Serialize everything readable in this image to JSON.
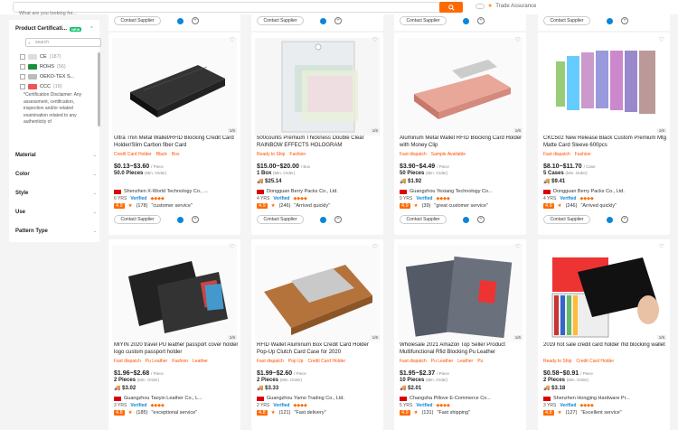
{
  "search": {
    "placeholder": "What are you looking for..."
  },
  "trade_assurance": "Trade Assurance",
  "sidebar": {
    "title": "Product Certificati...",
    "new_badge": "NEW",
    "search_placeholder": "search",
    "certs": [
      {
        "label": "CE",
        "count": "(187)",
        "color": "#333"
      },
      {
        "label": "ROHS",
        "count": "(56)",
        "color": "#1a8f3c"
      },
      {
        "label": "OEKO-TEX S...",
        "count": "",
        "color": "#888"
      },
      {
        "label": "CCC",
        "count": "(18)",
        "color": "#c00"
      }
    ],
    "disclaimer": "*Certification Disclaimer: Any assessment, certification, inspection and/or related examination related to any authenticity of",
    "facets": [
      "Material",
      "Color",
      "Style",
      "Use",
      "Pattern Type"
    ]
  },
  "contact_label": "Contact Supplier",
  "cards": [
    {
      "title": "Ultra Thin Metal Wallet/RFID Blocking Credit Card Holder/Slim Carbon fiber Card",
      "tags": [
        "Credit Card Holder",
        "Black",
        "Box"
      ],
      "price": "$0.13~$3.60",
      "unit": "/ Piece",
      "min": "50.0 Pieces",
      "min_note": "(Min. Order)",
      "ship": "",
      "supplier": "Shenzhen X-World Technology Co., ...",
      "yrs": "6 YRS",
      "rate": "\"customer service\"",
      "score": "4.9",
      "reviews": "(178)",
      "page": "1/6"
    },
    {
      "title": "500counts Premium Thickness Double Clear RAINBOW EFFECTS HOLOGRAM",
      "tags": [
        "Ready to Ship",
        "Fashion"
      ],
      "price": "$15.00~$20.00",
      "unit": "/ Box",
      "min": "1 Box",
      "min_note": "(Min. Order)",
      "ship": "$25.14",
      "supplier": "Dongguan Berry Packs Co., Ltd.",
      "yrs": "4 YRS",
      "rate": "\"Arrived quickly\"",
      "score": "4.9",
      "reviews": "(246)",
      "page": "1/6"
    },
    {
      "title": "Aluminum Metal Wallet RFID Blocking Card Holder with Money Clip",
      "tags": [
        "Fast dispatch",
        "Sample Available"
      ],
      "price": "$3.90~$4.49",
      "unit": "/ Piece",
      "min": "50 Pieces",
      "min_note": "(Min. Order)",
      "ship": "$1.92",
      "supplier": "Guangzhou Yexiang Technology Co...",
      "yrs": "9 YRS",
      "rate": "\"great customer service\"",
      "score": "4.9",
      "reviews": "(39)",
      "page": "1/6"
    },
    {
      "title": "CKC502 New Release Black Custom Premium Mtg Matte Card Sleeve 600pcs",
      "tags": [
        "Fast dispatch",
        "Fashion"
      ],
      "price": "$8.10~$11.70",
      "unit": "/ Case",
      "min": "5 Cases",
      "min_note": "(Min. Order)",
      "ship": "$9.41",
      "supplier": "Dongguan Berry Packs Co., Ltd.",
      "yrs": "4 YRS",
      "rate": "\"Arrived quickly\"",
      "score": "4.9",
      "reviews": "(246)",
      "page": "1/6"
    },
    {
      "title": "MIYIN 2020 travel PU leather passport cover holder logo custom passport holder",
      "tags": [
        "Fast dispatch",
        "Pu Leather",
        "Fashion",
        "Leather"
      ],
      "price": "$1.96~$2.68",
      "unit": "/ Piece",
      "min": "2 Pieces",
      "min_note": "(Min. Order)",
      "ship": "$3.02",
      "supplier": "Guangzhou Taoyin Leather Co., L...",
      "yrs": "3 YRS",
      "rate": "\"exceptional service\"",
      "score": "4.8",
      "reviews": "(185)",
      "page": "1/6"
    },
    {
      "title": "RFID Wallet Aluminum Box Credit Card Holder Pop-Up Clutch Card Case for 2020",
      "tags": [
        "Fast dispatch",
        "Pop Up",
        "Credit Card Holder"
      ],
      "price": "$1.99~$2.60",
      "unit": "/ Piece",
      "min": "2 Pieces",
      "min_note": "(Min. Order)",
      "ship": "$3.33",
      "supplier": "Guangzhou Yamo Trading Co., Ltd.",
      "yrs": "2 YRS",
      "rate": "\"Fast delivery\"",
      "score": "4.8",
      "reviews": "(121)",
      "page": "1/6"
    },
    {
      "title": "Wholesale 2021 Amazon Top Seller Product Multifunctional Rfid Blocking Pu Leather",
      "tags": [
        "Fast dispatch",
        "Pu Leather",
        "Leather",
        "Pu"
      ],
      "price": "$1.95~$2.37",
      "unit": "/ Piece",
      "min": "10 Pieces",
      "min_note": "(Min. Order)",
      "ship": "$2.01",
      "supplier": "Changsha Pillove E-Commerce Co...",
      "yrs": "5 YRS",
      "rate": "\"Fast shipping\"",
      "score": "4.9",
      "reviews": "(131)",
      "page": "1/6"
    },
    {
      "title": "2019 hot sale credit card holder rfid blocking wallet",
      "tags": [
        "Ready to Ship",
        "Credit Card Holder"
      ],
      "price": "$0.58~$0.91",
      "unit": "/ Piece",
      "min": "2 Pieces",
      "min_note": "(Min. Order)",
      "ship": "$3.18",
      "supplier": "Shenzhen Hongjing Hardware Pr...",
      "yrs": "3 YRS",
      "rate": "\"Excellent service\"",
      "score": "4.8",
      "reviews": "(127)",
      "page": "1/6"
    }
  ],
  "colors": {
    "accent": "#ff6a00",
    "verified": "#0a86d8"
  }
}
